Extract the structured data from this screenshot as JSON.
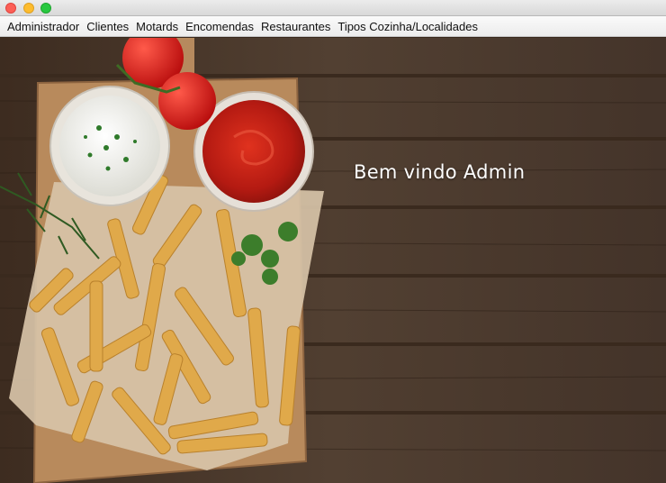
{
  "window": {
    "controls": [
      "close-button",
      "minimize-button",
      "maximize-button"
    ],
    "colors": {
      "close": "#fc5f57",
      "minimize": "#fdbc2e",
      "maximize": "#28c840"
    }
  },
  "menubar": {
    "items": [
      {
        "label": "Administrador"
      },
      {
        "label": "Clientes"
      },
      {
        "label": "Motards"
      },
      {
        "label": "Encomendas"
      },
      {
        "label": "Restaurantes"
      },
      {
        "label": "Tipos Cozinha/Localidades"
      }
    ]
  },
  "main": {
    "welcome_text": "Bem vindo Admin",
    "background_image": "fries-on-wooden-board-with-ketchup-and-mayo",
    "colors": {
      "wood_dark": "#3a2a1e",
      "wood_light": "#5a4636",
      "text": "#ffffff"
    }
  }
}
